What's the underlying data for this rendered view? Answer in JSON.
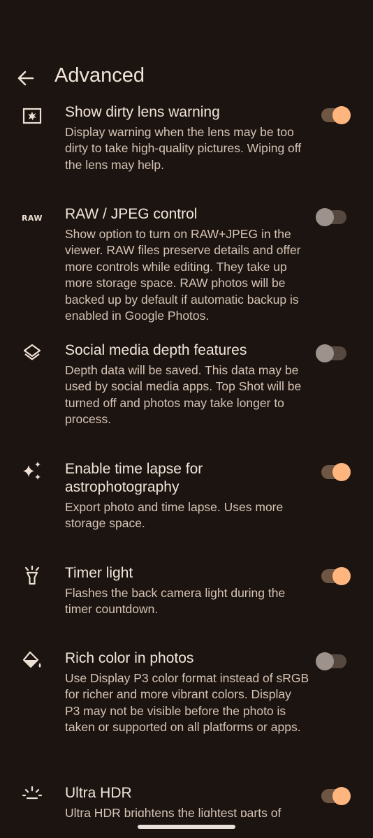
{
  "header": {
    "title": "Advanced"
  },
  "settings": [
    {
      "title": "Show dirty lens warning",
      "desc": "Display warning when the lens may be too dirty to take high-quality pictures. Wiping off the lens may help.",
      "icon": "dirty-lens-icon",
      "on": true
    },
    {
      "title": "RAW / JPEG control",
      "desc": "Show option to turn on RAW+JPEG in the viewer. RAW files preserve details and offer more controls while editing. They take up more storage space. RAW photos will be backed up by default if automatic backup is enabled in Google Photos.",
      "icon": "raw-icon",
      "icon_text": "RAW",
      "on": false
    },
    {
      "title": "Social media depth features",
      "desc": "Depth data will be saved. This data may be used by social media apps. Top Shot will be turned off and photos may take longer to process.",
      "icon": "layers-icon",
      "on": false
    },
    {
      "title": "Enable time lapse for astrophotography",
      "desc": "Export photo and time lapse. Uses more storage space.",
      "icon": "sparkle-icon",
      "on": true
    },
    {
      "title": "Timer light",
      "desc": "Flashes the back camera light during the timer countdown.",
      "icon": "light-icon",
      "on": true
    },
    {
      "title": "Rich color in photos",
      "desc": "Use Display P3 color format instead of sRGB for richer and more vibrant colors. Display P3 may not be visible before the photo is taken or supported on all platforms or apps.",
      "icon": "paint-bucket-icon",
      "on": false
    },
    {
      "title": "Ultra HDR",
      "desc": "Ultra HDR brightens the lightest parts of",
      "icon": "hdr-icon",
      "on": true
    }
  ],
  "colors": {
    "background": "#1c1410",
    "accent": "#ffb67e",
    "text": "#ede0d4"
  }
}
